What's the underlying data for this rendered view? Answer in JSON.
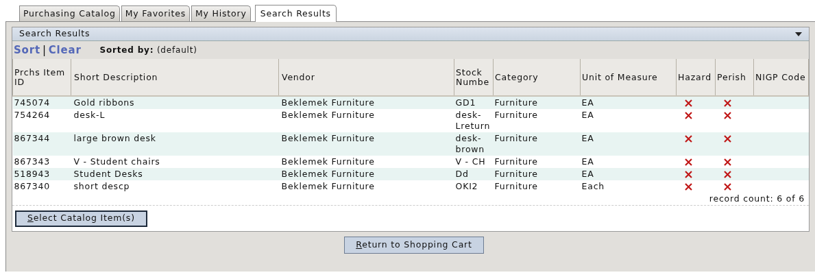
{
  "tabs": [
    {
      "label": "Purchasing Catalog",
      "selected": false
    },
    {
      "label": "My Favorites",
      "selected": false
    },
    {
      "label": "My History",
      "selected": false
    },
    {
      "label": "Search Results",
      "selected": true
    }
  ],
  "panel": {
    "title": "Search Results",
    "expanded": true
  },
  "sort_links": [
    "Sort",
    "Clear"
  ],
  "sort_separator": "|",
  "sorted_by": {
    "label": "Sorted by:",
    "value": "(default)"
  },
  "table": {
    "columns": [
      "Prchs Item ID",
      "Short Description",
      "Vendor",
      "Stock Numbe",
      "Category",
      "Unit of Measure",
      "Hazard",
      "Perish",
      "NIGP Code"
    ],
    "rows": [
      {
        "id": "745074",
        "description": "Gold ribbons",
        "vendor": "Beklemek Furniture",
        "stock": "GD1",
        "category": "Furniture",
        "unit": "EA",
        "hazard": false,
        "perish": false
      },
      {
        "id": "754264",
        "description": "desk-L",
        "vendor": "Beklemek Furniture",
        "stock": "desk-Lreturn",
        "category": "Furniture",
        "unit": "EA",
        "hazard": false,
        "perish": false
      },
      {
        "id": "867344",
        "description": "large brown desk",
        "vendor": "Beklemek Furniture",
        "stock": "desk-brown",
        "category": "Furniture",
        "unit": "EA",
        "hazard": false,
        "perish": false
      },
      {
        "id": "867343",
        "description": "V - Student chairs",
        "vendor": "Beklemek Furniture",
        "stock": "V - CH",
        "category": "Furniture",
        "unit": "EA",
        "hazard": false,
        "perish": false
      },
      {
        "id": "518943",
        "description": "Student Desks",
        "vendor": "Beklemek Furniture",
        "stock": "Dd",
        "category": "Furniture",
        "unit": "EA",
        "hazard": false,
        "perish": false
      },
      {
        "id": "867340",
        "description": "short descp",
        "vendor": "Beklemek Furniture",
        "stock": "OKI2",
        "category": "Furniture",
        "unit": "Each",
        "hazard": false,
        "perish": false
      }
    ]
  },
  "record_count": "record count: 6 of 6",
  "buttons": {
    "select": "Select Catalog Item(s)",
    "return": "Return to Shopping Cart"
  }
}
